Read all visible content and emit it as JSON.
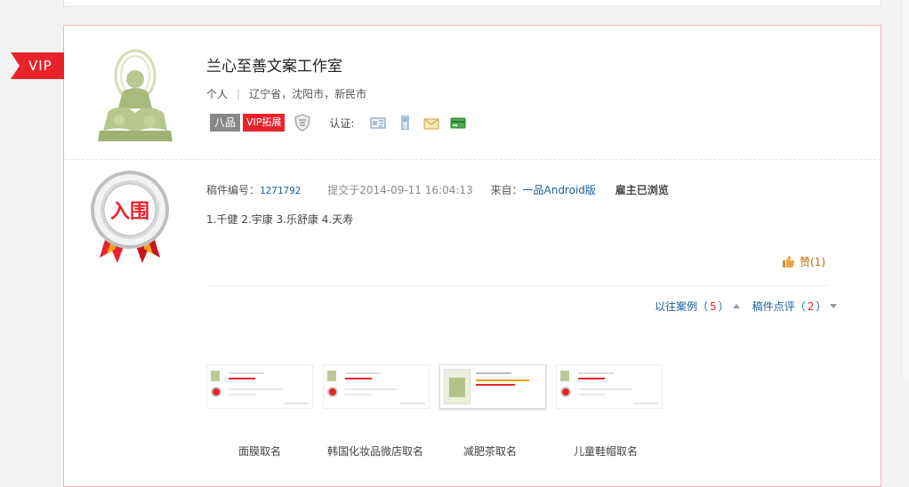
{
  "studio": {
    "name": "兰心至善文案工作室",
    "type": "个人",
    "location": "辽宁省，沈阳市，新民市",
    "vip_ribbon": "VIP",
    "level_badge": "八品",
    "vip_badge": "VIP拓展",
    "cert_label": "认证:",
    "cert_icons": [
      "id-card-icon",
      "phone-icon",
      "email-icon",
      "bank-card-icon"
    ]
  },
  "submission": {
    "award": "入围",
    "id_label": "稿件编号：",
    "id": "1271792",
    "submitted": "提交于2014-09-11 16:04:13",
    "from_label": "来自：",
    "source": "一品Android版",
    "status": "雇主已浏览",
    "content": "1.千健 2.宇康 3.乐舒康 4.天寿",
    "like_label": "赞(1)"
  },
  "links": {
    "cases_label": "以往案例（",
    "cases_count": "5",
    "cases_close": "）",
    "review_label": "稿件点评（",
    "review_count": "2",
    "review_close": "）"
  },
  "cases": [
    {
      "caption": "面膜取名"
    },
    {
      "caption": "韩国化妆品微店取名"
    },
    {
      "caption": "减肥茶取名"
    },
    {
      "caption": "儿童鞋帽取名"
    }
  ],
  "colors": {
    "accent_red": "#e8232b",
    "link_blue": "#1a5fa0",
    "card_border": "#f0b4b4"
  }
}
